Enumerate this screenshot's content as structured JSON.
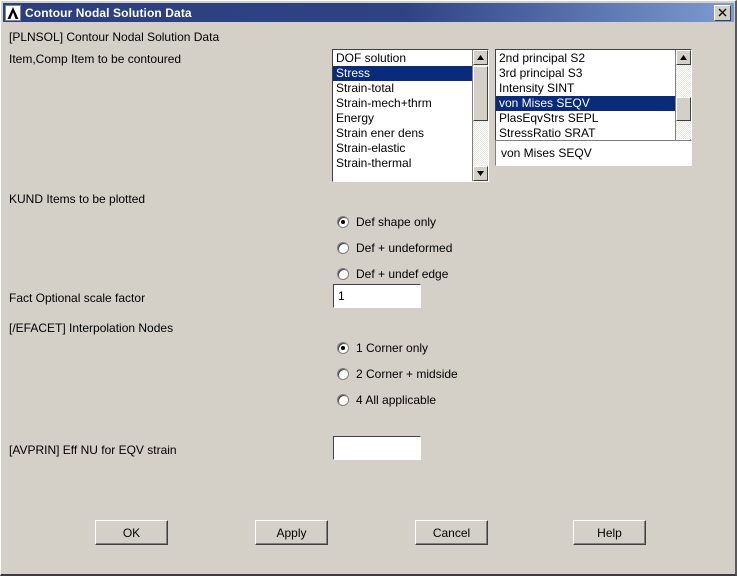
{
  "window": {
    "title": "Contour Nodal Solution Data",
    "icon": "ansys-logo-icon",
    "close_label": "x"
  },
  "header": {
    "command_label": "[PLNSOL]  Contour Nodal Solution Data",
    "item_comp_label": "Item,Comp   Item to be contoured"
  },
  "item_list": {
    "items": [
      "DOF solution",
      "Stress",
      "Strain-total",
      "Strain-mech+thrm",
      "Energy",
      "Strain ener dens",
      "Strain-elastic",
      "Strain-thermal"
    ],
    "selected_index": 1
  },
  "comp_list": {
    "items": [
      "2nd principal S2",
      "3rd principal S3",
      "Intensity   SINT",
      "von Mises   SEQV",
      "PlasEqvStrs SEPL",
      "StressRatio SRAT"
    ],
    "selected_index": 3
  },
  "selection_readout": {
    "value": "von Mises   SEQV"
  },
  "kund": {
    "label": "KUND   Items to be plotted",
    "options": [
      "Def shape only",
      "Def + undeformed",
      "Def + undef edge"
    ],
    "selected_index": 0
  },
  "fact": {
    "label": "Fact  Optional scale factor",
    "value": "1"
  },
  "efacet": {
    "label": "[/EFACET] Interpolation Nodes",
    "options": [
      "1 Corner only",
      "2 Corner + midside",
      "4 All applicable"
    ],
    "selected_index": 0
  },
  "avprin": {
    "label": "[AVPRIN]  Eff NU for EQV strain",
    "value": "",
    "placeholder": ""
  },
  "buttons": {
    "ok": "OK",
    "apply": "Apply",
    "cancel": "Cancel",
    "help": "Help"
  },
  "colors": {
    "dialog_background": "#d4d0c8",
    "titlebar_start": "#2c3f7e",
    "titlebar_end": "#7d9bd1",
    "selection_background": "#0a2a7a",
    "selection_text": "#ffffff"
  }
}
